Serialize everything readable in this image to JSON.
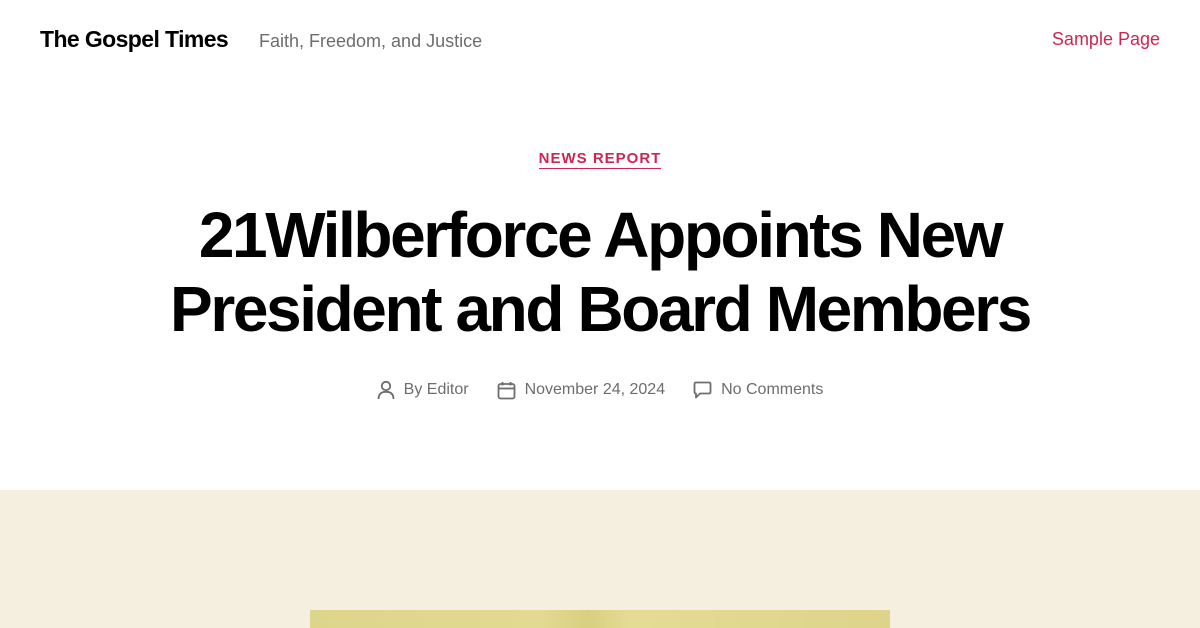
{
  "header": {
    "site_title": "The Gospel Times",
    "site_description": "Faith, Freedom, and Justice",
    "nav": [
      {
        "label": "Sample Page"
      }
    ]
  },
  "article": {
    "category": "NEWS REPORT",
    "title": "21Wilberforce Appoints New President and Board Members",
    "meta": {
      "author_prefix": "By",
      "author": "Editor",
      "date": "November 24, 2024",
      "comments": "No Comments"
    }
  },
  "colors": {
    "accent": "#cd2653",
    "meta_text": "#6d6d6d",
    "band_background": "#f5efe0"
  },
  "icons": [
    "user-icon",
    "calendar-icon",
    "comment-icon"
  ]
}
